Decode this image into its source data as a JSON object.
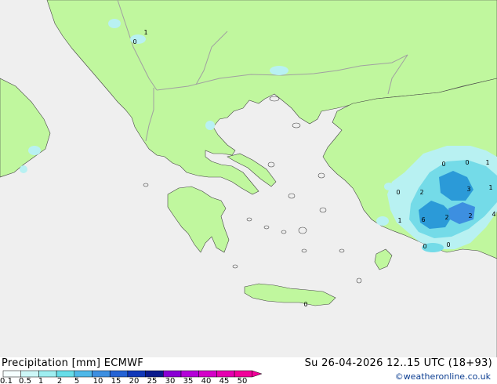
{
  "map": {
    "sea_color": "#efefef",
    "land_color": "#c0f79e",
    "border_color": "#a0a0a0",
    "coast_color": "#444444",
    "precip_light": "#b8f1f2",
    "precip_mid": "#74dbe8",
    "precip_strong": "#2b9ad8",
    "value_labels": [
      "1",
      "0",
      "0",
      "1",
      "2",
      "3",
      "1",
      "0",
      "2",
      "1",
      "6",
      "2",
      "4",
      "0",
      "0",
      "0",
      "0"
    ]
  },
  "legend": {
    "title": "Precipitation [mm]",
    "model": "ECMWF",
    "ticks": [
      "0.1",
      "0.5",
      "1",
      "2",
      "5",
      "10",
      "15",
      "20",
      "25",
      "30",
      "35",
      "40",
      "45",
      "50"
    ],
    "colors": [
      "#f5fefe",
      "#cdf7f7",
      "#9eeef0",
      "#66dde8",
      "#4fb8e8",
      "#3d8fe0",
      "#2563d4",
      "#1138b8",
      "#0a1a8c",
      "#8a00d4",
      "#b400d8",
      "#d400c8",
      "#e600b0",
      "#f2009a"
    ],
    "valid_time": "Su 26-04-2026 12..15 UTC (18+93)",
    "credit": "©weatheronline.co.uk"
  }
}
